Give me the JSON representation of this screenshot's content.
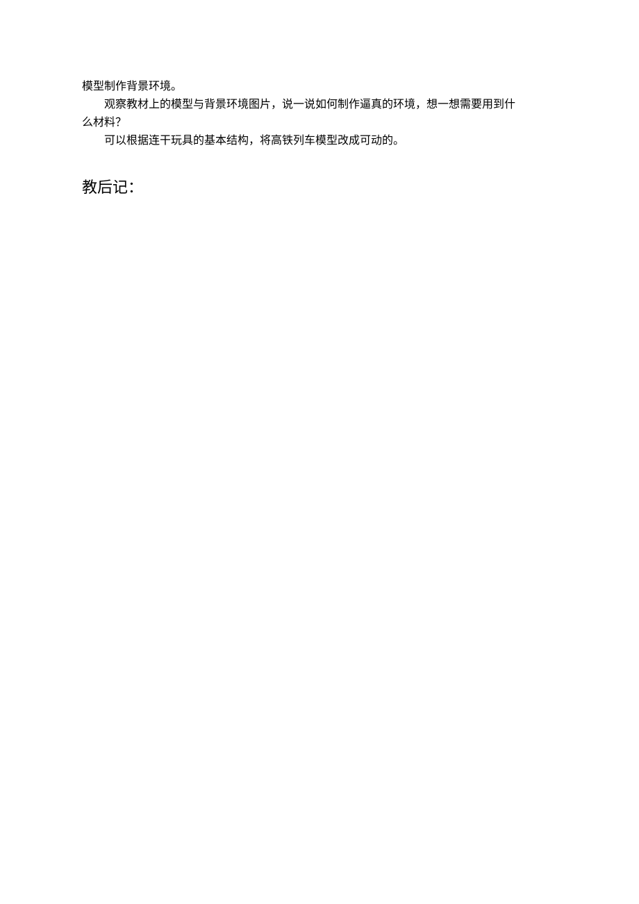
{
  "body": {
    "line1": "模型制作背景环境。",
    "line2": "观察教材上的模型与背景环境图片，说一说如何制作逼真的环境，想一想需要用到什",
    "line3": "么材料？",
    "line4": "可以根据连干玩具的基本结构，将高铁列车模型改成可动的。"
  },
  "heading": "教后记："
}
